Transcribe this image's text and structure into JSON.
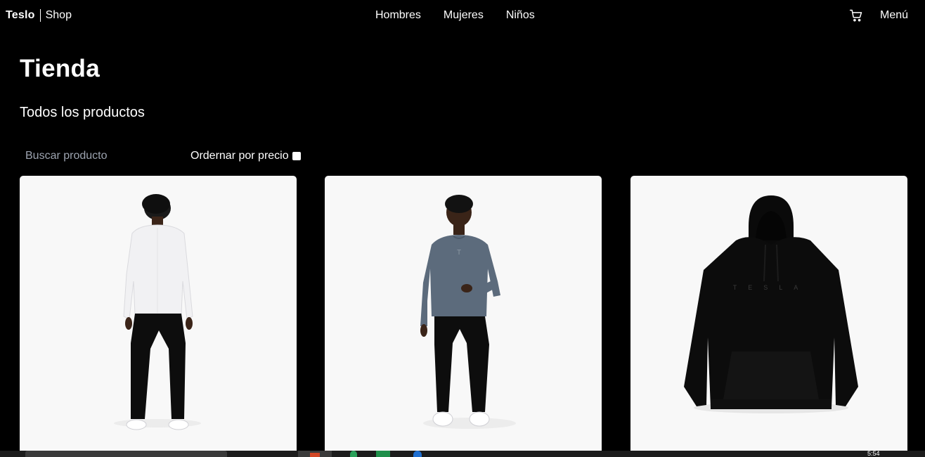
{
  "navbar": {
    "brand_name": "Teslo",
    "brand_suffix": "Shop",
    "links": [
      {
        "label": "Hombres"
      },
      {
        "label": "Mujeres"
      },
      {
        "label": "Niños"
      }
    ],
    "cart_icon": "shopping-cart-icon",
    "menu_label": "Menú"
  },
  "page": {
    "title": "Tienda",
    "subtitle": "Todos los productos"
  },
  "filters": {
    "search_placeholder": "Buscar producto",
    "sort_label": "Ordernar por precio",
    "sort_checked": false
  },
  "products": [
    {
      "image": "man-white-longsleeve-back-view"
    },
    {
      "image": "man-gray-crewneck-sweatshirt-front-view"
    },
    {
      "image": "black-tesla-hoodie",
      "print_text": "TESLA"
    }
  ],
  "taskbar": {
    "clock": "5:54"
  },
  "colors": {
    "background": "#000000",
    "text": "#ffffff",
    "card_background": "#f8f8f8",
    "placeholder": "#9ca3af"
  }
}
